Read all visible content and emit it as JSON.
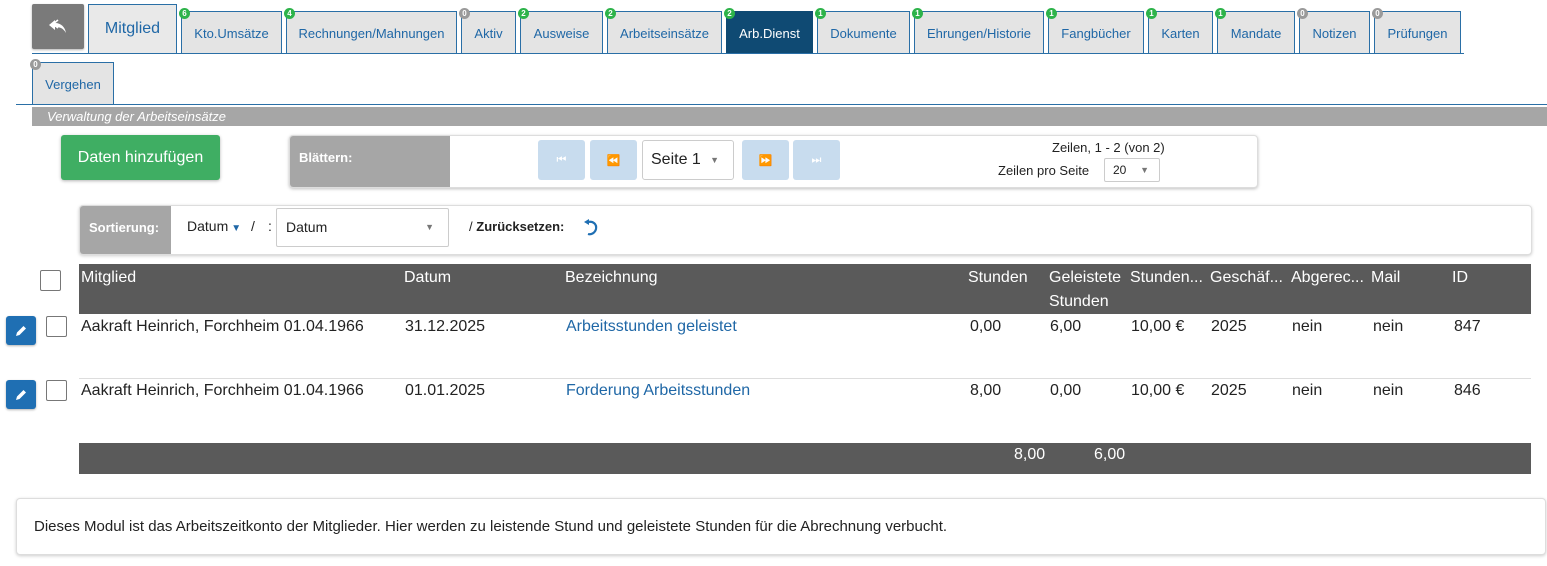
{
  "tabs": [
    {
      "label": "Mitglied",
      "badge": ""
    },
    {
      "label": "Kto.Umsätze",
      "badge": "6"
    },
    {
      "label": "Rechnungen/Mahnungen",
      "badge": "4"
    },
    {
      "label": "Aktiv",
      "badge": "0"
    },
    {
      "label": "Ausweise",
      "badge": "2"
    },
    {
      "label": "Arbeitseinsätze",
      "badge": "2"
    },
    {
      "label": "Arb.Dienst",
      "badge": "2"
    },
    {
      "label": "Dokumente",
      "badge": "1"
    },
    {
      "label": "Ehrungen/Historie",
      "badge": "1"
    },
    {
      "label": "Fangbücher",
      "badge": "1"
    },
    {
      "label": "Karten",
      "badge": "1"
    },
    {
      "label": "Mandate",
      "badge": "1"
    },
    {
      "label": "Notizen",
      "badge": "0"
    },
    {
      "label": "Prüfungen",
      "badge": "0"
    },
    {
      "label": "Vergehen",
      "badge": "0"
    }
  ],
  "section_title": "Verwaltung der Arbeitseinsätze",
  "add_button": "Daten hinzufügen",
  "pager": {
    "label": "Blättern:",
    "page": "Seite 1",
    "rows_info": "Zeilen, 1 - 2 (von 2)",
    "rows_per_page_label": "Zeilen pro Seite",
    "rows_per_page": "20"
  },
  "sort": {
    "label": "Sortierung:",
    "field": "Datum",
    "separator": "/",
    "colon": ":",
    "select_value": "Datum",
    "reset_prefix": "/",
    "reset_label": "Zurücksetzen:"
  },
  "table": {
    "headers": {
      "mitglied": "Mitglied",
      "datum": "Datum",
      "bezeichnung": "Bezeichnung",
      "stunden": "Stunden",
      "geleistete1": "Geleistete",
      "geleistete2": "Stunden",
      "stundensatz": "Stunden...",
      "geschaeft": "Geschäf...",
      "abgerechnet": "Abgerec...",
      "mail": "Mail",
      "id": "ID"
    },
    "rows": [
      {
        "mitglied": "Aakraft Heinrich, Forchheim 01.04.1966",
        "datum": "31.12.2025",
        "bezeichnung": "Arbeitsstunden geleistet",
        "stunden": "0,00",
        "geleistete": "6,00",
        "stundensatz": "10,00 €",
        "geschaeft": "2025",
        "abgerechnet": "nein",
        "mail": "nein",
        "id": "847"
      },
      {
        "mitglied": "Aakraft Heinrich, Forchheim 01.04.1966",
        "datum": "01.01.2025",
        "bezeichnung": "Forderung Arbeitsstunden",
        "stunden": "8,00",
        "geleistete": "0,00",
        "stundensatz": "10,00 €",
        "geschaeft": "2025",
        "abgerechnet": "nein",
        "mail": "nein",
        "id": "846"
      }
    ],
    "totals": {
      "stunden": "8,00",
      "geleistete": "6,00"
    }
  },
  "info_text": "Dieses Modul ist das Arbeitszeitkonto der Mitglieder. Hier werden zu leistende Stund und geleistete Stunden für die Abrechnung verbucht.",
  "colors": {
    "accent": "#0f4a73",
    "link": "#1f67a6",
    "success": "#3fae63",
    "header_bg": "#5a5a5a"
  }
}
